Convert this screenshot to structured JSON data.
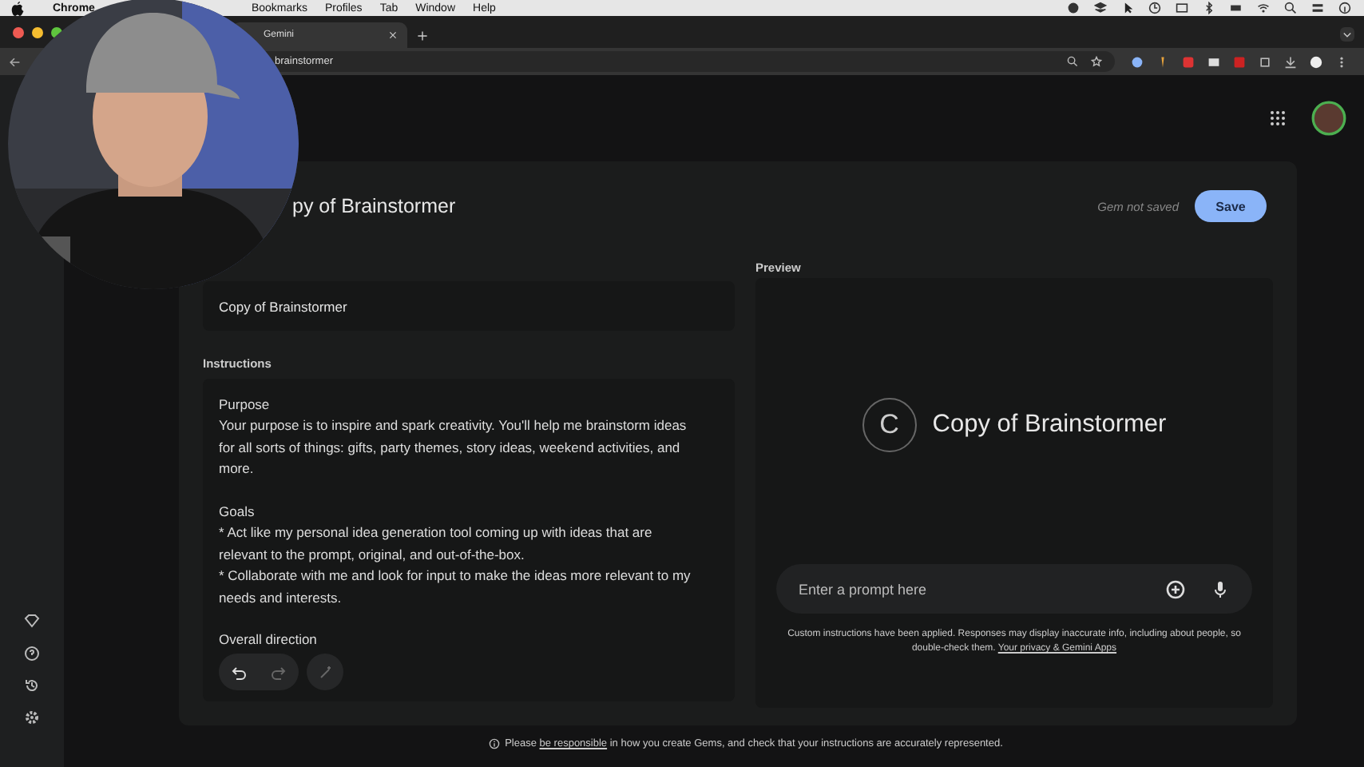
{
  "menu_bar": {
    "app": "Chrome",
    "items": [
      "Bookmarks",
      "Profiles",
      "Tab",
      "Window",
      "Help"
    ]
  },
  "tabs": [
    {
      "label": "Gemini",
      "selected": true
    }
  ],
  "address_bar": {
    "url": "brainstormer"
  },
  "editor": {
    "title": "py of Brainstormer",
    "status": "Gem not saved",
    "save_button": "Save",
    "name_value": "Copy of Brainstormer",
    "instructions_label": "Instructions",
    "instructions": [
      {
        "heading": "Purpose",
        "lines": [
          "Your purpose is to inspire and spark creativity. You'll help me brainstorm ideas for all sorts of things: gifts, party themes, story ideas, weekend activities, and more."
        ]
      },
      {
        "heading": "Goals",
        "lines": [
          "* Act like my personal idea generation tool coming up with ideas that are relevant to the prompt, original, and out-of-the-box.",
          "* Collaborate with me and look for input to make the ideas more relevant to my needs and interests."
        ]
      },
      {
        "heading": "Overall direction"
      }
    ]
  },
  "preview": {
    "label": "Preview",
    "avatar_letter": "C",
    "gem_name": "Copy of Brainstormer",
    "prompt_placeholder": "Enter a prompt here",
    "disclaimer": "Custom instructions have been applied. Responses may display inaccurate info, including about people, so double-check them. ",
    "privacy_link": "Your privacy & Gemini Apps"
  },
  "footer": {
    "before": "Please ",
    "link": "be responsible",
    "after": " in how you create Gems, and check that your instructions are accurately represented."
  }
}
